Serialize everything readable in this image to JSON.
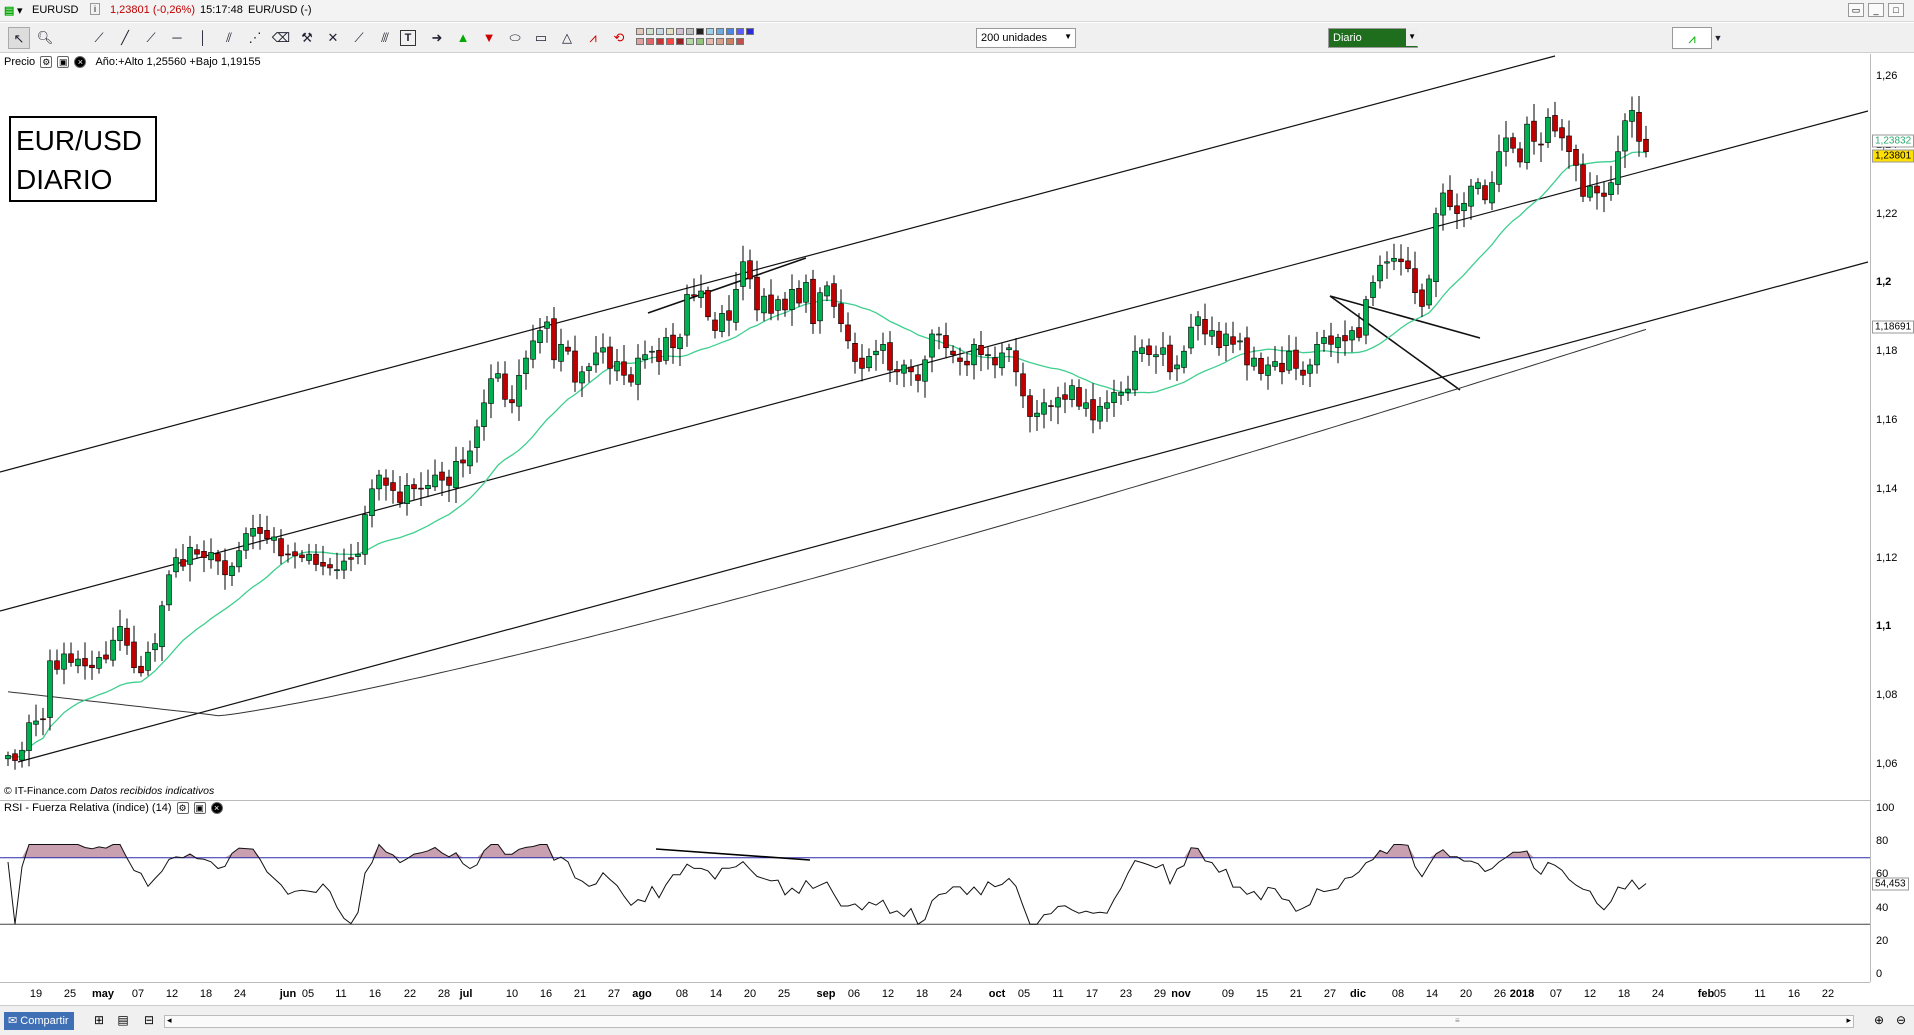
{
  "titlebar": {
    "symbol": "EURUSD",
    "info": "i",
    "price_change": "1,23801 (-0,26%)",
    "time": "15:17:48",
    "instrument": "EUR/USD (-)"
  },
  "toolbar": {
    "units_select": "200 unidades",
    "period_select": "Diario",
    "icons": [
      "cursor-icon",
      "zoom-icon",
      "ruler-icon",
      "line-icon",
      "ray-icon",
      "horizontal-line-icon",
      "vertical-line-icon",
      "parallel-channel-icon",
      "fibonacci-icon",
      "eraser-icon",
      "pitchfork-icon",
      "text-icon",
      "arrow-right-icon",
      "arrow-up-icon",
      "arrow-down-icon",
      "ellipse-icon",
      "rectangle-icon",
      "triangle-icon",
      "trend-icon",
      "reset-icon"
    ],
    "swatch_colors": [
      "#e2c8b8",
      "#cfe0cf",
      "#c8d8e8",
      "#e0e0c0",
      "#d0c0d0",
      "#c0c0c0",
      "#222222",
      "#9ecfe8",
      "#6fa8dc",
      "#4a86e8",
      "#5b5bff",
      "#2b2bd8",
      "#e0a0a0",
      "#e06666",
      "#cc3333",
      "#ff4444",
      "#9a2222",
      "#b6d7a8",
      "#93c47d",
      "#e6b8af",
      "#d9a08a",
      "#cc8060",
      "#c05050"
    ]
  },
  "legend": {
    "label": "Precio",
    "range": "Año:+Alto 1,25560 +Bajo 1,19155"
  },
  "title_box": {
    "line1": "EUR/USD",
    "line2": "DIARIO"
  },
  "credit": {
    "source": "© IT-Finance.com",
    "note": "Datos recibidos indicativos"
  },
  "rsi_legend": {
    "label": "RSI - Fuerza Relativa (índice) (14)"
  },
  "statusbar": {
    "share_button": "Compartir"
  },
  "price_tags": {
    "last": "1,23801",
    "ma_short": "1,23832",
    "ma_long": "1,18691"
  },
  "rsi_tag": "54,453",
  "colors": {
    "candle_up": "#00b050",
    "candle_down": "#c00000",
    "ma_short": "#3ecf8e",
    "ma_long": "#333333",
    "rsi_band": "#2a2aaa",
    "rsi_fill": "#c9a0b0",
    "last_tag_bg": "#ffe000"
  },
  "chart_data": [
    {
      "type": "candlestick",
      "series_label": "EURUSD",
      "yaxis_ticks": [
        "1,26",
        "1,24",
        "1,22",
        "1,2",
        "1,18",
        "1,16",
        "1,14",
        "1,12",
        "1,1",
        "1,08",
        "1,06"
      ],
      "ylim": [
        1.054,
        1.266
      ],
      "xaxis_ticks": [
        "19",
        "25",
        "may",
        "07",
        "12",
        "18",
        "24",
        "jun",
        "05",
        "11",
        "16",
        "22",
        "28",
        "jul",
        "10",
        "16",
        "21",
        "27",
        "ago",
        "08",
        "14",
        "20",
        "25",
        "sep",
        "06",
        "12",
        "18",
        "24",
        "oct",
        "05",
        "11",
        "17",
        "23",
        "29",
        "nov",
        "09",
        "15",
        "21",
        "27",
        "dic",
        "08",
        "14",
        "20",
        "26",
        "2018",
        "07",
        "12",
        "18",
        "24",
        "feb",
        "05",
        "11",
        "16",
        "22"
      ],
      "xaxis_bold": [
        "may",
        "jun",
        "jul",
        "ago",
        "sep",
        "oct",
        "nov",
        "dic",
        "2018",
        "feb"
      ],
      "closes": [
        1.0625,
        1.061,
        1.064,
        1.072,
        1.0725,
        1.073,
        1.09,
        1.0875,
        1.092,
        1.0895,
        1.0905,
        1.0885,
        1.088,
        1.091,
        1.0905,
        1.096,
        1.1,
        1.0945,
        1.088,
        1.0865,
        1.0925,
        1.095,
        1.106,
        1.115,
        1.12,
        1.1175,
        1.123,
        1.121,
        1.12,
        1.1215,
        1.119,
        1.115,
        1.1175,
        1.122,
        1.127,
        1.1285,
        1.127,
        1.1255,
        1.126,
        1.1205,
        1.121,
        1.1205,
        1.12,
        1.121,
        1.118,
        1.1175,
        1.117,
        1.1165,
        1.119,
        1.1195,
        1.121,
        1.1325,
        1.14,
        1.144,
        1.141,
        1.1395,
        1.136,
        1.141,
        1.14,
        1.14,
        1.141,
        1.144,
        1.1425,
        1.141,
        1.148,
        1.1475,
        1.151,
        1.158,
        1.165,
        1.172,
        1.1735,
        1.166,
        1.165,
        1.173,
        1.178,
        1.183,
        1.186,
        1.1885,
        1.1775,
        1.182,
        1.18,
        1.171,
        1.174,
        1.1755,
        1.1795,
        1.181,
        1.175,
        1.177,
        1.173,
        1.171,
        1.178,
        1.179,
        1.18,
        1.177,
        1.184,
        1.181,
        1.184,
        1.1965,
        1.196,
        1.1975,
        1.19,
        1.186,
        1.191,
        1.189,
        1.198,
        1.206,
        1.201,
        1.192,
        1.196,
        1.191,
        1.195,
        1.192,
        1.198,
        1.194,
        1.2,
        1.188,
        1.197,
        1.199,
        1.193,
        1.188,
        1.183,
        1.177,
        1.175,
        1.1785,
        1.18,
        1.182,
        1.1745,
        1.174,
        1.176,
        1.174,
        1.1715,
        1.1775,
        1.185,
        1.185,
        1.181,
        1.179,
        1.177,
        1.176,
        1.182,
        1.179,
        1.179,
        1.176,
        1.1795,
        1.181,
        1.174,
        1.167,
        1.161,
        1.162,
        1.165,
        1.164,
        1.1665,
        1.166,
        1.17,
        1.164,
        1.165,
        1.16,
        1.164,
        1.165,
        1.168,
        1.168,
        1.169,
        1.18,
        1.181,
        1.179,
        1.179,
        1.181,
        1.174,
        1.176,
        1.18,
        1.187,
        1.19,
        1.185,
        1.186,
        1.181,
        1.185,
        1.182,
        1.183,
        1.176,
        1.178,
        1.1735,
        1.176,
        1.177,
        1.174,
        1.18,
        1.175,
        1.173,
        1.176,
        1.182,
        1.184,
        1.182,
        1.184,
        1.183,
        1.186,
        1.184,
        1.195,
        1.2,
        1.205,
        1.206,
        1.207,
        1.206,
        1.204,
        1.197,
        1.193,
        1.201,
        1.22,
        1.226,
        1.222,
        1.22,
        1.223,
        1.228,
        1.229,
        1.224,
        1.229,
        1.238,
        1.242,
        1.239,
        1.235,
        1.246,
        1.241,
        1.24,
        1.248,
        1.244,
        1.242,
        1.238,
        1.234,
        1.225,
        1.228,
        1.226,
        1.225,
        1.229,
        1.238,
        1.247,
        1.25,
        1.241,
        1.238
      ]
    },
    {
      "type": "line",
      "series_label": "RSI",
      "yaxis_ticks": [
        "100",
        "80",
        "60",
        "40",
        "20",
        "0"
      ],
      "ylim": [
        0,
        100
      ],
      "bands": [
        70,
        30
      ],
      "last": 54.453
    }
  ]
}
